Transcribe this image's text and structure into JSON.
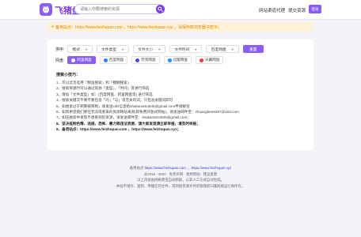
{
  "header": {
    "logo_text": "飞猪盘",
    "search_placeholder": "请输入你要搜索的资源",
    "nav": [
      "网站渠道代理",
      "提交资源"
    ],
    "login": "登录"
  },
  "notice": "备用站点：https://www.feizhupan.com ，https://www.feizhupan.xyz ，请保存到浏览器书签中。",
  "filters": {
    "sort_label": "排序:",
    "dropdowns": [
      "模式",
      "文件类型",
      "文件大小",
      "文件时间",
      "百度网盘"
    ],
    "reset": "重置"
  },
  "netdisk": {
    "label": "网盘:",
    "options": [
      {
        "name": "阿里网盘",
        "active": true
      },
      {
        "name": "百度网盘",
        "active": false
      },
      {
        "name": "夸克网盘",
        "active": false
      },
      {
        "name": "迅雷网盘",
        "active": false
      },
      {
        "name": "天翼网盘",
        "active": false
      }
    ]
  },
  "tips": {
    "title": "搜索小技巧：",
    "items": [
      "1、可以灵活选用「精准搜索」和「模糊搜索」",
      "2、搜索资源时可以通过资源「类型」、「时间」等进行筛选",
      "3、增加「文件类型」如：(百度网盘、阿里网盘等) 进行筛选",
      "4、搜索关键次不要不要包含「的」「与」等无关的词，只包含关键词即可",
      "5、如搜索过于频繁被限制，请发送UID信息给shakanamo945@gmail.com申请解封",
      "6、如有希望我们要在无法或者来的资源网站来源(即免费开放式网站)，请发送邮件至：zhuangbee6287@163.com",
      "7、如在搜索中发现不想看到的资源，请发送邮件至：shakanamo945@gmail.com；",
      "8、坚决抵制色情、违规、恐怖、暴力等违法资源，请大家发现请立即举报，请及时举报；",
      "9、备用站点：https://www.feizhupan.com ，https://www.feizhupan.xyz；"
    ],
    "site1": "https://www.feizhupan.com",
    "site2": "https://www.feizhupan.xyz"
  },
  "footer": {
    "line1_prefix": "备用站点",
    "site1": "https://www.feizhupan.com",
    "site2": "https://www.feizhupan.xyz",
    "line2": "@2016 - 2020 · 免责声明 · 使用帮助 · 建议反馈",
    "line3": "以上内容由网络爬虫自动抓取，以非人工方式自动生成。",
    "line4": "本站不储存、复制、传播任何文件，其网盘资源文件的管辖权归属网盘运行商所有。"
  },
  "colors": {
    "accent": "#8b5cf6",
    "brand_text": "#7c3aed",
    "notice_bg": "#fdf1d7",
    "notice_text": "#e08a00",
    "link": "#3b3bd6"
  },
  "icons": [
    "pig-logo-icon",
    "search-icon",
    "speaker-icon",
    "chevron-down-icon"
  ]
}
